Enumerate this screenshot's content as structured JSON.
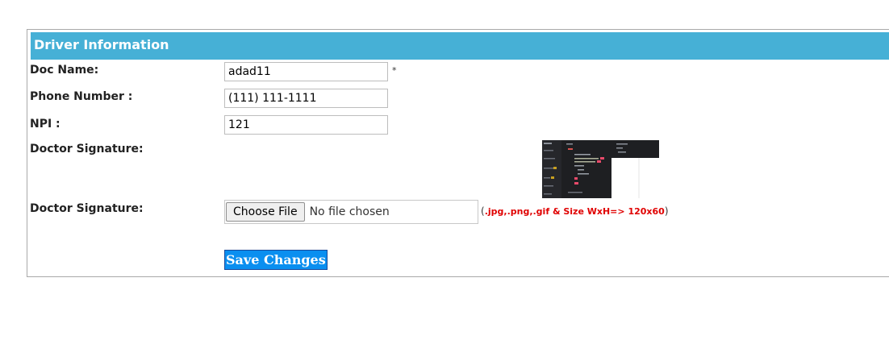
{
  "section": {
    "title": "Driver Information"
  },
  "fields": {
    "doc_name": {
      "label": "Doc Name:",
      "value": "adad11",
      "required_mark": "*"
    },
    "phone": {
      "label": "Phone Number :",
      "value": "(111) 111-1111"
    },
    "npi": {
      "label": "NPI :",
      "value": "121"
    },
    "signature_display": {
      "label": "Doctor Signature:"
    },
    "signature_upload": {
      "label": "Doctor Signature:",
      "button_label": "Choose File",
      "status": "No file chosen",
      "hint_open": "(",
      "hint_text": ".jpg,.png,.gif & Size WxH=> 120x60",
      "hint_close": ")"
    }
  },
  "actions": {
    "save_label": "Save Changes"
  },
  "colors": {
    "header_bg": "#46b0d6",
    "save_bg": "#0a8ff0",
    "hint_red": "#e00000"
  }
}
